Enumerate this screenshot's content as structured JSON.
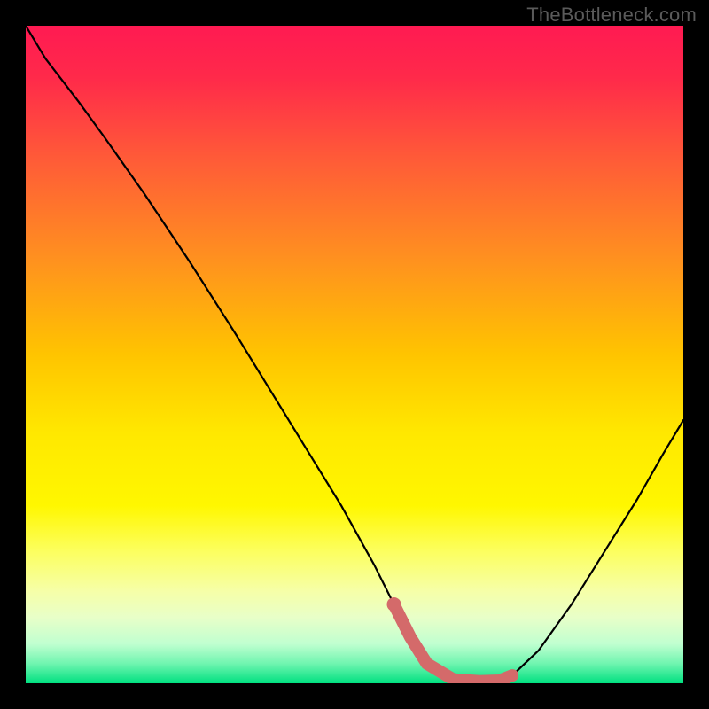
{
  "watermark": "TheBottleneck.com",
  "chart_data": {
    "type": "line",
    "title": "",
    "xlabel": "",
    "ylabel": "",
    "xlim": [
      0,
      100
    ],
    "ylim": [
      0,
      100
    ],
    "gradient_stops": [
      {
        "offset": 0.0,
        "color": "#ff1a52"
      },
      {
        "offset": 0.08,
        "color": "#ff2a4a"
      },
      {
        "offset": 0.2,
        "color": "#ff5a38"
      },
      {
        "offset": 0.35,
        "color": "#ff8f20"
      },
      {
        "offset": 0.5,
        "color": "#ffc400"
      },
      {
        "offset": 0.62,
        "color": "#ffe800"
      },
      {
        "offset": 0.73,
        "color": "#fff700"
      },
      {
        "offset": 0.8,
        "color": "#fcff60"
      },
      {
        "offset": 0.86,
        "color": "#f6ffa8"
      },
      {
        "offset": 0.9,
        "color": "#e8ffc8"
      },
      {
        "offset": 0.94,
        "color": "#c0ffd0"
      },
      {
        "offset": 0.97,
        "color": "#70f5b0"
      },
      {
        "offset": 1.0,
        "color": "#00e080"
      }
    ],
    "series": [
      {
        "name": "bottleneck-curve",
        "x": [
          0.0,
          3.0,
          8.0,
          12.0,
          18.0,
          25.0,
          32.0,
          40.0,
          48.0,
          53.0,
          56.0,
          58.5,
          61.0,
          65.0,
          69.0,
          72.0,
          74.0,
          78.0,
          83.0,
          88.0,
          93.0,
          97.0,
          100.0
        ],
        "y": [
          100.0,
          95.0,
          88.5,
          83.0,
          74.5,
          64.0,
          53.0,
          40.0,
          27.0,
          18.0,
          12.0,
          7.0,
          3.0,
          0.6,
          0.3,
          0.4,
          1.2,
          5.0,
          12.0,
          20.0,
          28.0,
          35.0,
          40.0
        ]
      }
    ],
    "highlight": {
      "name": "optimal-zone",
      "color": "#d46a6a",
      "x": [
        56.0,
        58.5,
        61.0,
        65.0,
        69.0,
        72.0,
        74.0
      ],
      "y": [
        12.0,
        7.0,
        3.0,
        0.6,
        0.3,
        0.4,
        1.2
      ],
      "dot_x": 56.0,
      "dot_y": 12.0
    }
  }
}
